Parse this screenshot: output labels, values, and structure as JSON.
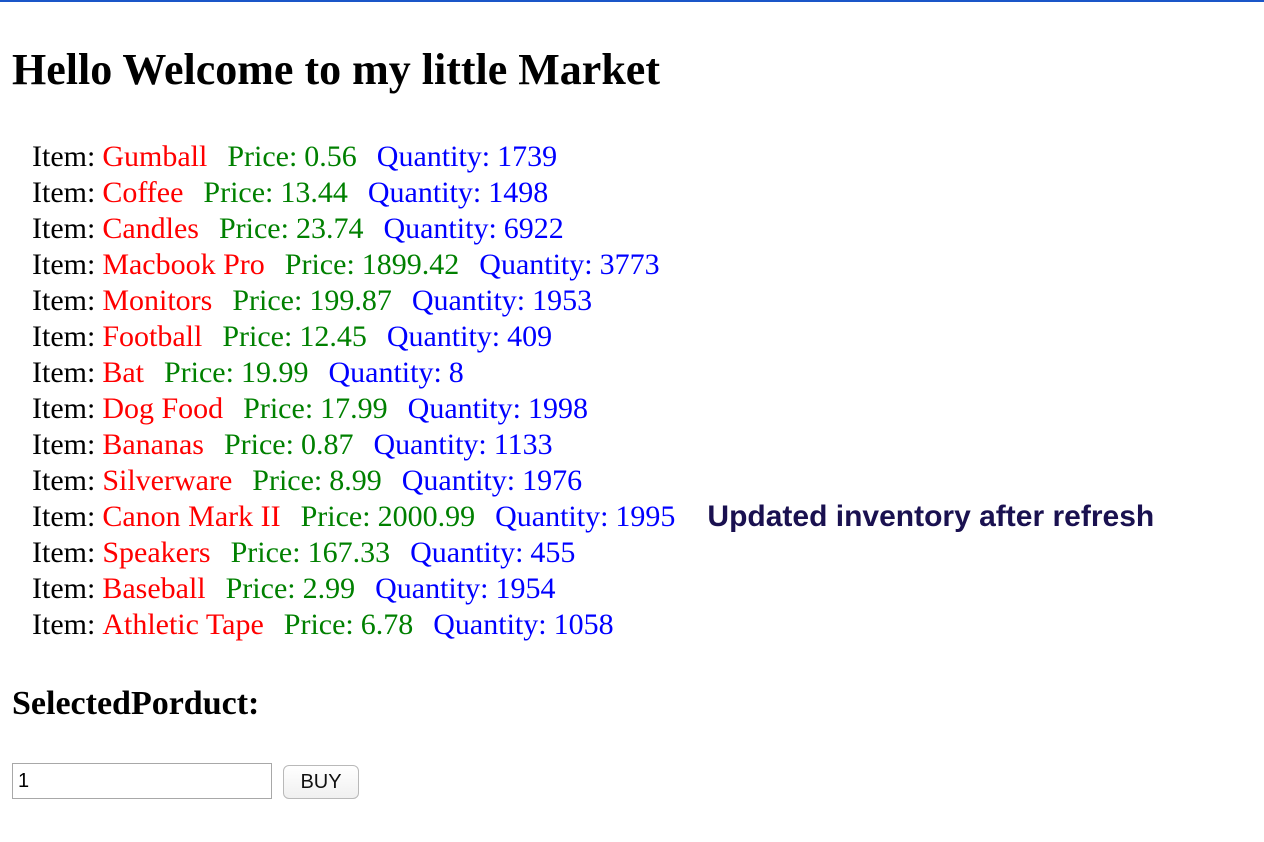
{
  "header": {
    "title": "Hello Welcome to my little Market"
  },
  "labels": {
    "item": "Item:",
    "price": "Price:",
    "quantity": "Quantity:"
  },
  "items": [
    {
      "name": "Gumball",
      "price": "0.56",
      "quantity": "1739",
      "note": ""
    },
    {
      "name": "Coffee",
      "price": "13.44",
      "quantity": "1498",
      "note": ""
    },
    {
      "name": "Candles",
      "price": "23.74",
      "quantity": "6922",
      "note": ""
    },
    {
      "name": "Macbook Pro",
      "price": "1899.42",
      "quantity": "3773",
      "note": ""
    },
    {
      "name": "Monitors",
      "price": "199.87",
      "quantity": "1953",
      "note": ""
    },
    {
      "name": "Football",
      "price": "12.45",
      "quantity": "409",
      "note": ""
    },
    {
      "name": "Bat",
      "price": "19.99",
      "quantity": "8",
      "note": ""
    },
    {
      "name": "Dog Food",
      "price": "17.99",
      "quantity": "1998",
      "note": ""
    },
    {
      "name": "Bananas",
      "price": "0.87",
      "quantity": "1133",
      "note": ""
    },
    {
      "name": "Silverware",
      "price": "8.99",
      "quantity": "1976",
      "note": ""
    },
    {
      "name": "Canon Mark II",
      "price": "2000.99",
      "quantity": "1995",
      "note": "Updated inventory after refresh"
    },
    {
      "name": "Speakers",
      "price": "167.33",
      "quantity": "455",
      "note": ""
    },
    {
      "name": "Baseball",
      "price": "2.99",
      "quantity": "1954",
      "note": ""
    },
    {
      "name": "Athletic Tape",
      "price": "6.78",
      "quantity": "1058",
      "note": ""
    }
  ],
  "selection": {
    "title": "SelectedPorduct:",
    "input_value": "1",
    "buy_label": "BUY"
  },
  "colors": {
    "item_name": "#ff0000",
    "price": "#008000",
    "quantity": "#0000ff",
    "note": "#1a1150"
  }
}
